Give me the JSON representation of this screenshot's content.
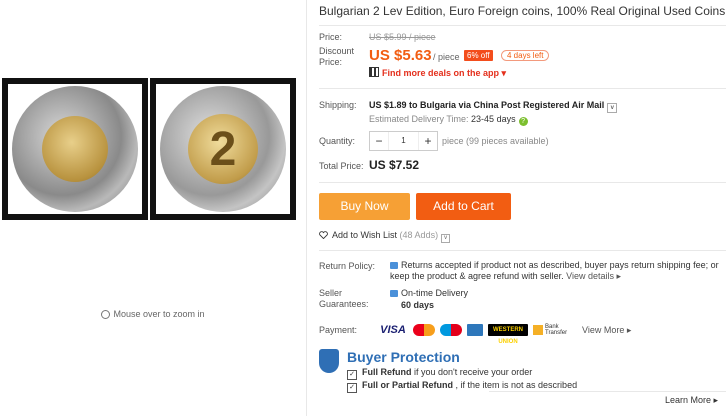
{
  "product": {
    "title": "Bulgarian 2 Lev Edition, Euro Foreign coins, 100% Real Original Used Coins"
  },
  "gallery": {
    "zoom_hint": "Mouse over to zoom in"
  },
  "price": {
    "label": "Price:",
    "original": "US $5.99 / piece",
    "discount_label_1": "Discount",
    "discount_label_2": "Price:",
    "discounted": "US $5.63",
    "per_piece": "/ piece",
    "off_badge": "6% off",
    "days_left": "4 days left",
    "more_deals": "Find more deals on the app"
  },
  "shipping": {
    "label": "Shipping:",
    "text": "US $1.89 to Bulgaria via China Post Registered Air Mail",
    "est_label": "Estimated Delivery Time:",
    "est_value": "23-45 days"
  },
  "quantity": {
    "label": "Quantity:",
    "value": "1",
    "minus": "−",
    "plus": "+",
    "note": "piece (99 pieces available)"
  },
  "total": {
    "label": "Total Price:",
    "value": "US $7.52"
  },
  "buttons": {
    "buy_now": "Buy Now",
    "add_to_cart": "Add to Cart"
  },
  "wishlist": {
    "label": "Add to Wish List",
    "count": "(48 Adds)"
  },
  "return_policy": {
    "label": "Return Policy:",
    "text": "Returns accepted if product not as described, buyer pays return shipping fee; or keep the product & agree refund with seller.",
    "link": "View details"
  },
  "seller_guarantees": {
    "label_1": "Seller",
    "label_2": "Guarantees:",
    "delivery": "On-time Delivery",
    "days": "60 days"
  },
  "payment": {
    "label": "Payment:",
    "visa": "VISA",
    "wu": "WESTERN UNION",
    "bank_1": "Bank",
    "bank_2": "Transfer",
    "view_more": "View More"
  },
  "buyer_protection": {
    "title": "Buyer Protection",
    "line1_bold": "Full Refund",
    "line1_rest": " if you don't receive your order",
    "line2_bold": "Full or Partial Refund",
    "line2_rest": " , if the item is not as described",
    "learn_more": "Learn More"
  }
}
